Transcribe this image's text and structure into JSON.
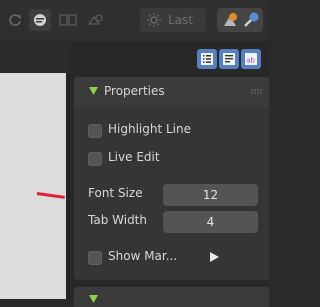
{
  "header": {
    "last_label": "Last"
  },
  "sidebar": {
    "properties_title": "Properties",
    "highlight_line_label": "Highlight Line",
    "live_edit_label": "Live Edit",
    "font_size_label": "Font Size",
    "font_size_value": "12",
    "tab_width_label": "Tab Width",
    "tab_width_value": "4",
    "show_margin_label": "Show Mar..."
  },
  "colors": {
    "accent": "#5680c2",
    "panel_bg": "#353535",
    "editor_bg": "#dcdcdc",
    "cursor_marker": "#e0203a"
  }
}
